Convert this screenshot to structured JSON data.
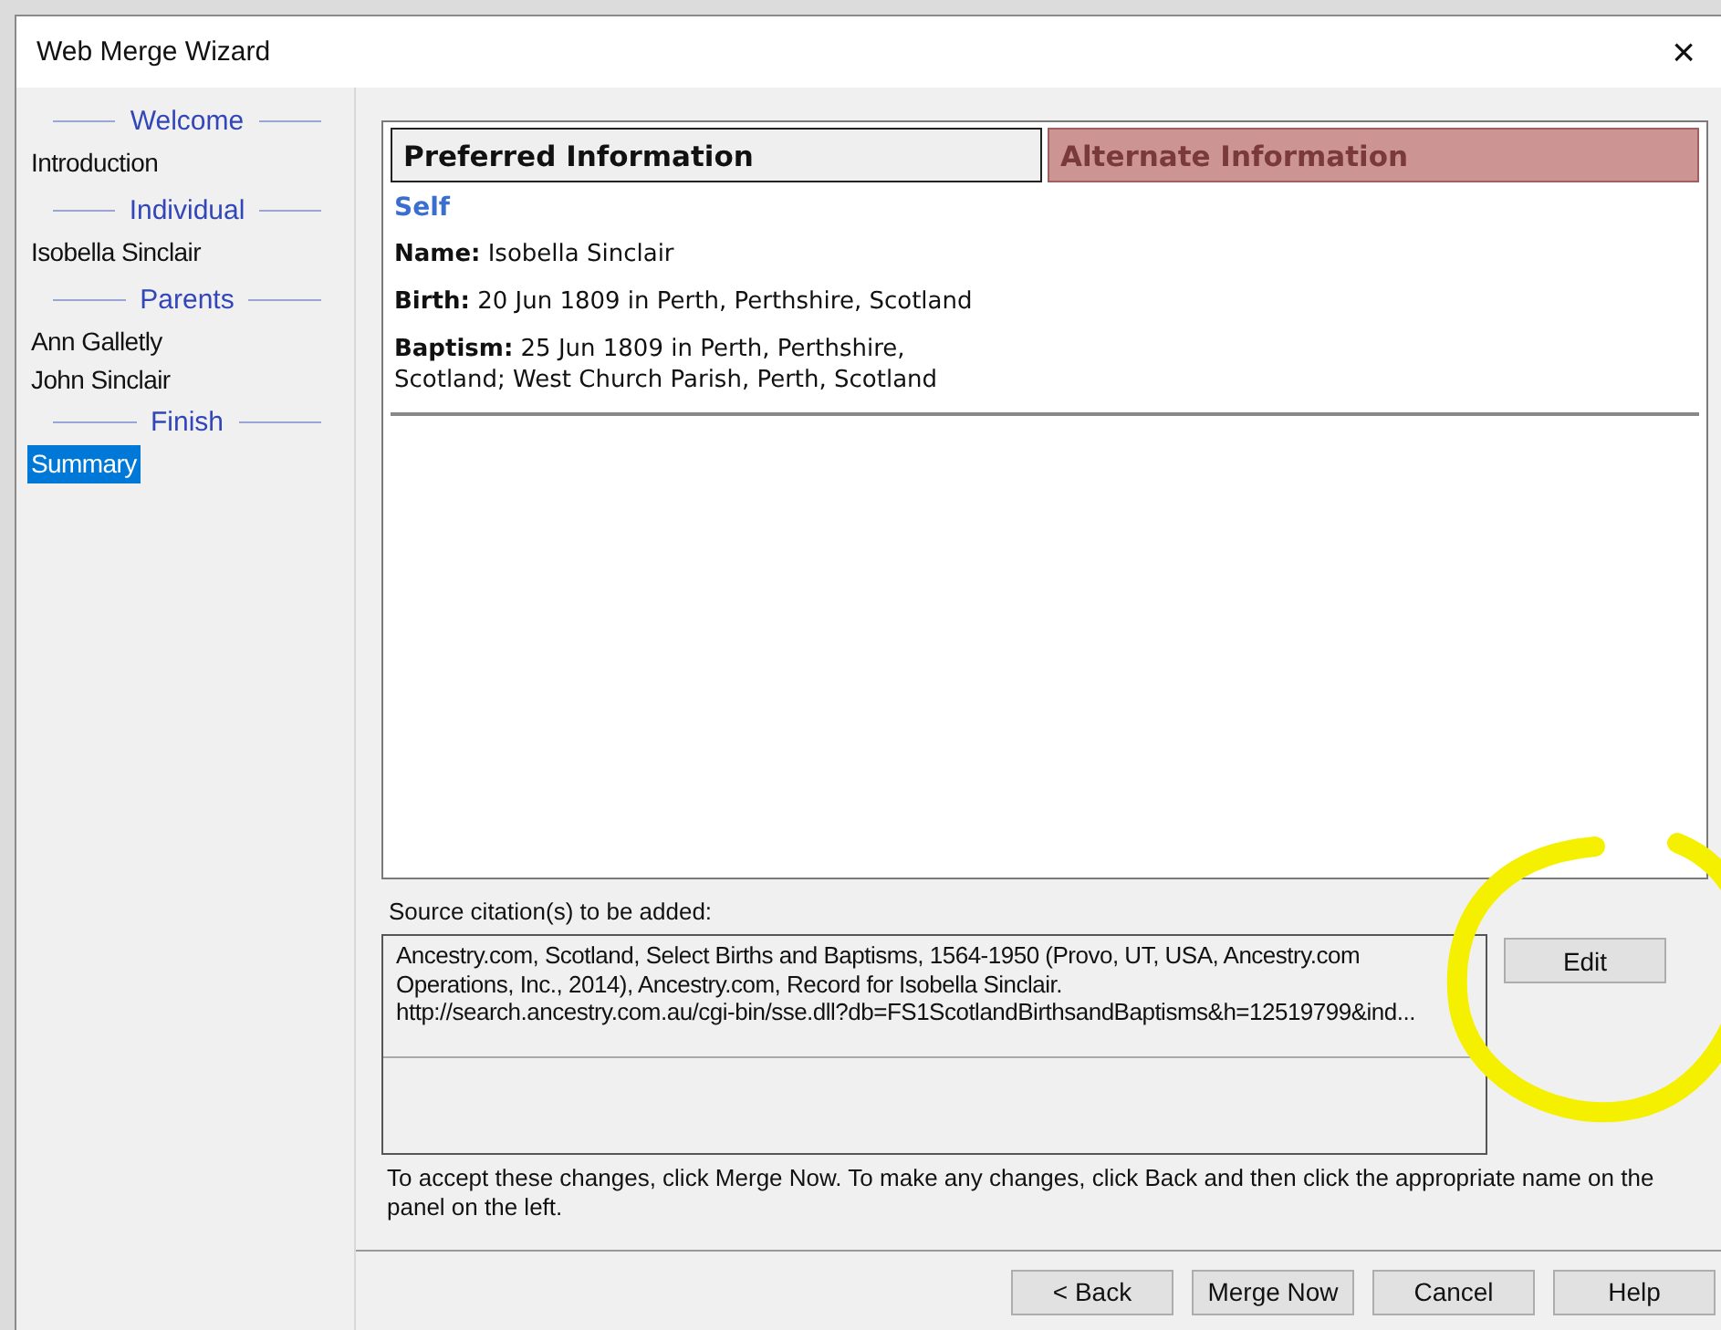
{
  "window": {
    "title": "Web Merge Wizard",
    "close": "×"
  },
  "sidebar": {
    "sections": [
      {
        "heading": "Welcome",
        "items": [
          {
            "label": "Introduction",
            "selected": false
          }
        ]
      },
      {
        "heading": "Individual",
        "items": [
          {
            "label": "Isobella Sinclair",
            "selected": false
          }
        ]
      },
      {
        "heading": "Parents",
        "items": [
          {
            "label": "Ann Galletly",
            "selected": false
          },
          {
            "label": "John Sinclair",
            "selected": false
          }
        ]
      },
      {
        "heading": "Finish",
        "items": [
          {
            "label": "Summary",
            "selected": true
          }
        ]
      }
    ]
  },
  "summary": {
    "columns": [
      {
        "label": "Preferred Information",
        "selected": true
      },
      {
        "label": "Alternate Information",
        "selected": false
      }
    ],
    "section": "Self",
    "facts": [
      "**Name:** Isobella Sinclair",
      "**Birth:** 20 Jun 1809 in Perth, Perthshire, Scotland",
      "**Baptism:** 25 Jun 1809 in Perth, Perthshire, Scotland; West Church Parish, Perth, Scotland"
    ]
  },
  "citations": {
    "label": "Source citation(s) to be added:",
    "lines": [
      "Ancestry.com, Scotland, Select Births and Baptisms, 1564-1950 (Provo, UT, USA, Ancestry.com",
      "Operations, Inc., 2014), Ancestry.com, Record for Isobella Sinclair.",
      "http://search.ancestry.com.au/cgi-bin/sse.dll?db=FS1ScotlandBirthsandBaptisms&h=12519799&ind..."
    ],
    "edit_button": "Edit"
  },
  "instructions": "To accept these changes, click Merge Now.  To make any changes, click Back and then click the appropriate name on the panel on the left.",
  "buttons": [
    "< Back",
    "Merge Now",
    "Cancel",
    "Help"
  ]
}
